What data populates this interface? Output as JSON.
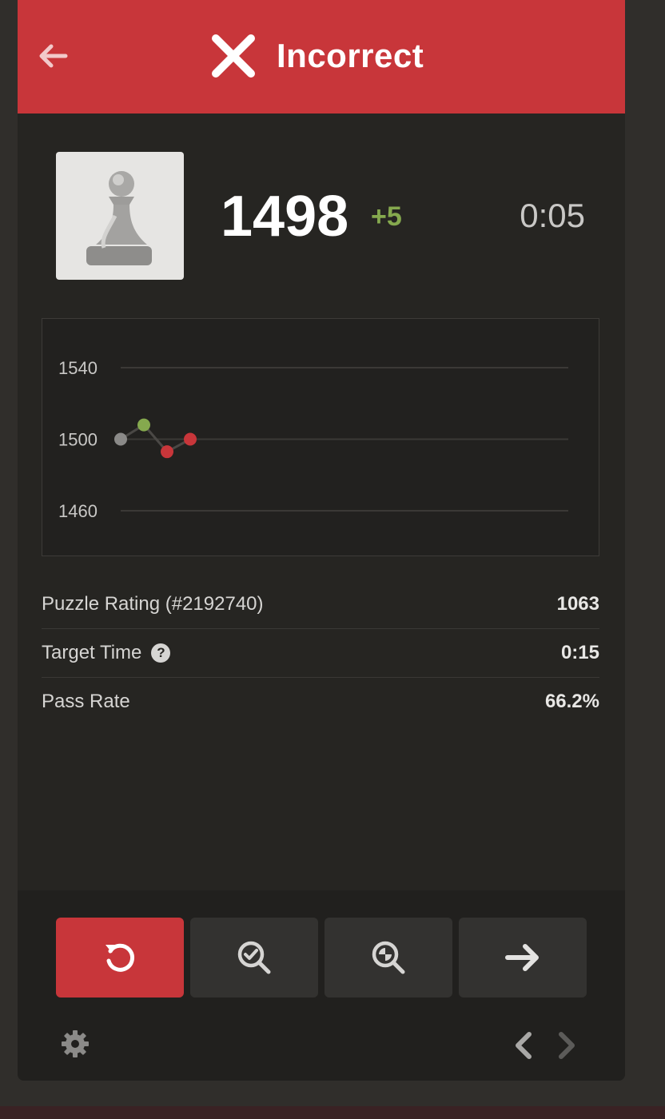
{
  "header": {
    "title": "Incorrect",
    "back_icon": "arrow-left-icon",
    "status_icon": "x-icon",
    "bg_color": "#c8363a"
  },
  "player": {
    "avatar_icon": "pawn-icon",
    "rating": "1498",
    "rating_delta": "+5",
    "delta_color": "#85a94e",
    "timer": "0:05"
  },
  "chart_data": {
    "type": "line",
    "y_ticks": [
      "1540",
      "1500",
      "1460"
    ],
    "ylim": [
      1460,
      1540
    ],
    "points": [
      {
        "x": 1,
        "y": 1500,
        "color": "#8b8a88"
      },
      {
        "x": 2,
        "y": 1508,
        "color": "#85a94e"
      },
      {
        "x": 3,
        "y": 1493,
        "color": "#c8363a"
      },
      {
        "x": 4,
        "y": 1500,
        "color": "#c8363a"
      }
    ],
    "grid": true
  },
  "stats": [
    {
      "label": "Puzzle Rating (#2192740)",
      "value": "1063",
      "help": false
    },
    {
      "label": "Target Time",
      "value": "0:15",
      "help": true
    },
    {
      "label": "Pass Rate",
      "value": "66.2%",
      "help": false
    }
  ],
  "help_glyph": "?",
  "actions": [
    {
      "icon": "retry-icon",
      "variant": "red"
    },
    {
      "icon": "magnify-check-icon",
      "variant": "dark"
    },
    {
      "icon": "magnify-analysis-icon",
      "variant": "dark"
    },
    {
      "icon": "arrow-right-icon",
      "variant": "dark"
    }
  ],
  "footer": {
    "settings_icon": "gear-icon",
    "prev_icon": "chevron-left-icon",
    "next_icon": "chevron-right-icon"
  }
}
